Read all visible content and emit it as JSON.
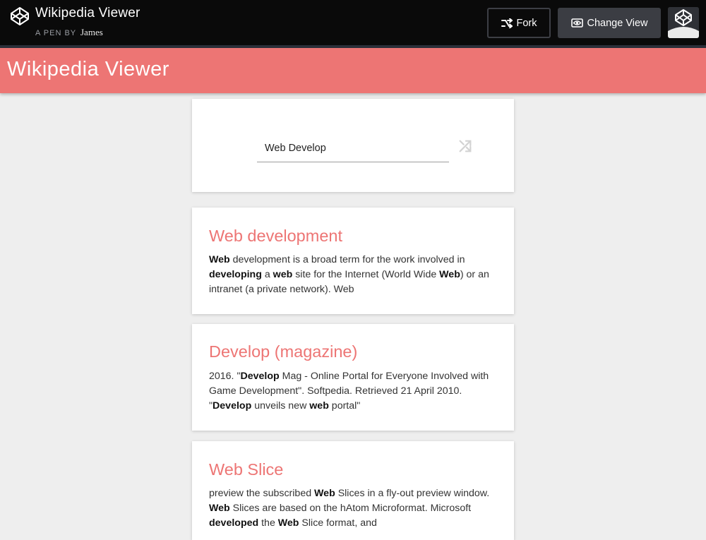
{
  "codepen": {
    "pen_title": "Wikipedia Viewer",
    "byline_prefix": "A PEN BY",
    "author": "James",
    "fork_label": "Fork",
    "change_view_label": "Change View",
    "icons": {
      "logo": "codepen-logo-icon",
      "fork": "fork-icon",
      "view": "eye-icon",
      "avatar": "codepen-avatar-icon"
    }
  },
  "app": {
    "title": "Wikipedia Viewer",
    "accent_color": "#ed7574",
    "search": {
      "value": "Web Develop",
      "icon": "shuffle-icon"
    }
  },
  "results": [
    {
      "title": "Web development",
      "snippet_parts": [
        {
          "text": "Web",
          "bold": true
        },
        {
          "text": " development is a broad term for the work involved in ",
          "bold": false
        },
        {
          "text": "developing",
          "bold": true
        },
        {
          "text": " a ",
          "bold": false
        },
        {
          "text": "web",
          "bold": true
        },
        {
          "text": " site for the Internet (World Wide ",
          "bold": false
        },
        {
          "text": "Web",
          "bold": true
        },
        {
          "text": ") or an intranet (a private network). Web",
          "bold": false
        }
      ]
    },
    {
      "title": "Develop (magazine)",
      "snippet_parts": [
        {
          "text": "2016.  \"",
          "bold": false
        },
        {
          "text": "Develop",
          "bold": true
        },
        {
          "text": " Mag - Online Portal for Everyone Involved with Game Development\". Softpedia. Retrieved 21 April 2010. \"",
          "bold": false
        },
        {
          "text": "Develop",
          "bold": true
        },
        {
          "text": " unveils new ",
          "bold": false
        },
        {
          "text": "web",
          "bold": true
        },
        {
          "text": " portal\"",
          "bold": false
        }
      ]
    },
    {
      "title": "Web Slice",
      "snippet_parts": [
        {
          "text": "preview the subscribed ",
          "bold": false
        },
        {
          "text": "Web",
          "bold": true
        },
        {
          "text": " Slices in a fly-out preview window. ",
          "bold": false
        },
        {
          "text": "Web",
          "bold": true
        },
        {
          "text": " Slices are based on the hAtom Microformat. Microsoft ",
          "bold": false
        },
        {
          "text": "developed",
          "bold": true
        },
        {
          "text": " the ",
          "bold": false
        },
        {
          "text": "Web",
          "bold": true
        },
        {
          "text": " Slice format, and",
          "bold": false
        }
      ]
    }
  ]
}
